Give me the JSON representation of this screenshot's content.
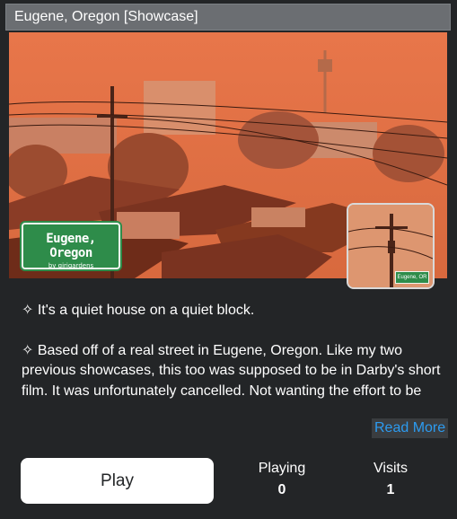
{
  "title": "Eugene, Oregon [Showcase]",
  "thumbnail": {
    "sign_title": "Eugene, Oregon",
    "sign_subtitle": "by qirigardens",
    "inset_sign": "Eugene, OR"
  },
  "description": {
    "line1": "✧ It's a quiet house on a quiet block.",
    "line2": "✧ Based off of a real street in Eugene, Oregon. Like my two previous showcases, this too was supposed to be in Darby's short film. It was unfortunately cancelled. Not wanting the effort to be wasted, I spruced it up and turned it into a real tourist attraction. I didn't want to block off any part of",
    "read_more": "Read More"
  },
  "play_label": "Play",
  "stats": [
    {
      "label": "Playing",
      "value": "0"
    },
    {
      "label": "Visits",
      "value": "1"
    }
  ],
  "colors": {
    "background": "#232527",
    "title_bar": "#6b6e72",
    "link": "#2c9bf0",
    "sky": "#e0713f"
  }
}
